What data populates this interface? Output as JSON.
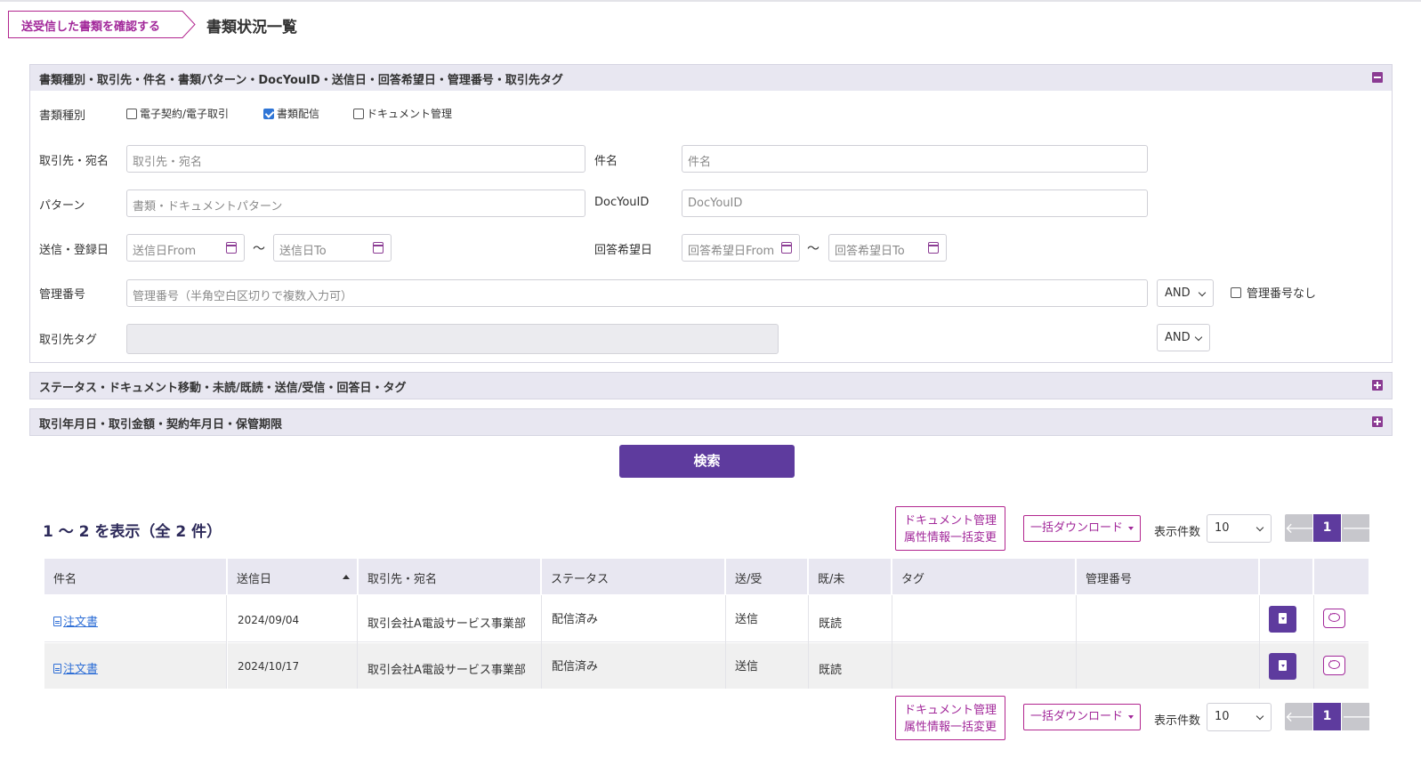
{
  "breadcrumb": {
    "link_label": "送受信した書類を確認する",
    "title": "書類状況一覧"
  },
  "panels": {
    "basic": {
      "title": "書類種別・取引先・件名・書類パターン・DocYouID・送信日・回答希望日・管理番号・取引先タグ"
    },
    "status": {
      "title": "ステータス・ドキュメント移動・未読/既読・送信/受信・回答日・タグ"
    },
    "trade": {
      "title": "取引年月日・取引金額・契約年月日・保管期限"
    }
  },
  "form": {
    "doc_type_label": "書類種別",
    "doc_types": [
      {
        "label": "電子契約/電子取引",
        "checked": false
      },
      {
        "label": "書類配信",
        "checked": true
      },
      {
        "label": "ドキュメント管理",
        "checked": false
      }
    ],
    "partner_label": "取引先・宛名",
    "partner_placeholder": "取引先・宛名",
    "subject_label": "件名",
    "subject_placeholder": "件名",
    "pattern_label": "パターン",
    "pattern_placeholder": "書類・ドキュメントパターン",
    "docyouid_label": "DocYouID",
    "docyouid_placeholder": "DocYouID",
    "sent_date_label": "送信・登録日",
    "sent_from_placeholder": "送信日From",
    "sent_to_placeholder": "送信日To",
    "tilde": "～",
    "reply_date_label": "回答希望日",
    "reply_from_placeholder": "回答希望日From",
    "reply_to_placeholder": "回答希望日To",
    "mgmt_label": "管理番号",
    "mgmt_placeholder": "管理番号（半角空白区切りで複数入力可）",
    "mgmt_operator": "AND",
    "no_mgmt_label": "管理番号なし",
    "tag_label": "取引先タグ",
    "tag_operator": "AND"
  },
  "search_button": "検索",
  "results": {
    "count_text": "1 ～ 2 を表示（全 2 件）",
    "bulk_attr_line1": "ドキュメント管理",
    "bulk_attr_line2": "属性情報一括変更",
    "bulk_download": "一括ダウンロード",
    "page_size_label": "表示件数",
    "page_size": "10",
    "prev": "🡐",
    "current_page": "1",
    "next": "🡒",
    "columns": [
      "件名",
      "送信日",
      "取引先・宛名",
      "ステータス",
      "送/受",
      "既/未",
      "タグ",
      "管理番号",
      "",
      ""
    ],
    "rows": [
      {
        "subject": "注文書",
        "date": "2024/09/04",
        "partner": "取引会社A電設サービス事業部",
        "status": "配信済み",
        "direction": "送信",
        "read": "既読",
        "tag": "",
        "mgmt": ""
      },
      {
        "subject": "注文書",
        "date": "2024/10/17",
        "partner": "取引会社A電設サービス事業部",
        "status": "配信済み",
        "direction": "送信",
        "read": "既読",
        "tag": "",
        "mgmt": ""
      }
    ]
  },
  "colors": {
    "accent": "#5e3b9e",
    "magenta": "#a2289a",
    "header_bg": "#e8e7f1",
    "link": "#2f6fd6"
  }
}
